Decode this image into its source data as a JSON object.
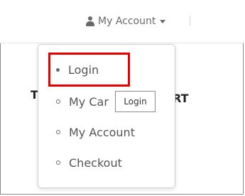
{
  "header": {
    "account_label": "My Account",
    "user_icon": "user-icon",
    "caret_icon": "caret-down-icon"
  },
  "background": {
    "left_glyph": "T",
    "right_text": "RT"
  },
  "dropdown": {
    "items": [
      {
        "label": "Login",
        "bullet": "filled"
      },
      {
        "label": "My Car",
        "bullet": "hollow"
      },
      {
        "label": "My Account",
        "bullet": "hollow"
      },
      {
        "label": "Checkout",
        "bullet": "hollow"
      }
    ]
  },
  "tooltip": {
    "text": "Login"
  },
  "colors": {
    "highlight": "#e60000",
    "text": "#555555",
    "border": "#cfcfcf"
  }
}
